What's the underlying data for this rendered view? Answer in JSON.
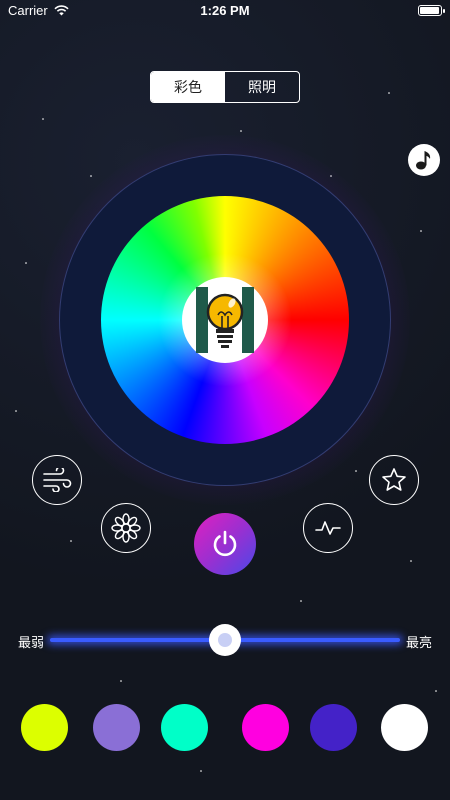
{
  "status_bar": {
    "carrier": "Carrier",
    "time": "1:26 PM",
    "wifi_icon": "wifi-icon",
    "battery_level": 1.0
  },
  "mode_tabs": [
    {
      "label": "彩色",
      "active": true
    },
    {
      "label": "照明",
      "active": false
    }
  ],
  "music_button_icon": "music-note-icon",
  "color_wheel": {
    "center_icon": "lightbulb-icon"
  },
  "effect_buttons": {
    "wind": "wind-icon",
    "star": "star-icon",
    "flower": "flower-icon",
    "pulse": "pulse-icon",
    "power": "power-icon"
  },
  "brightness": {
    "min_label": "最弱",
    "max_label": "最亮",
    "value": 0.5
  },
  "preset_colors": [
    "#dcff00",
    "#8a6fd6",
    "#00ffc8",
    "#ff00e0",
    "#4422c8",
    "#ffffff"
  ],
  "colors": {
    "background": "#12161f",
    "slider_track": "#3a5cff",
    "power_gradient_start": "#e020c0",
    "power_gradient_end": "#4a48e8"
  }
}
